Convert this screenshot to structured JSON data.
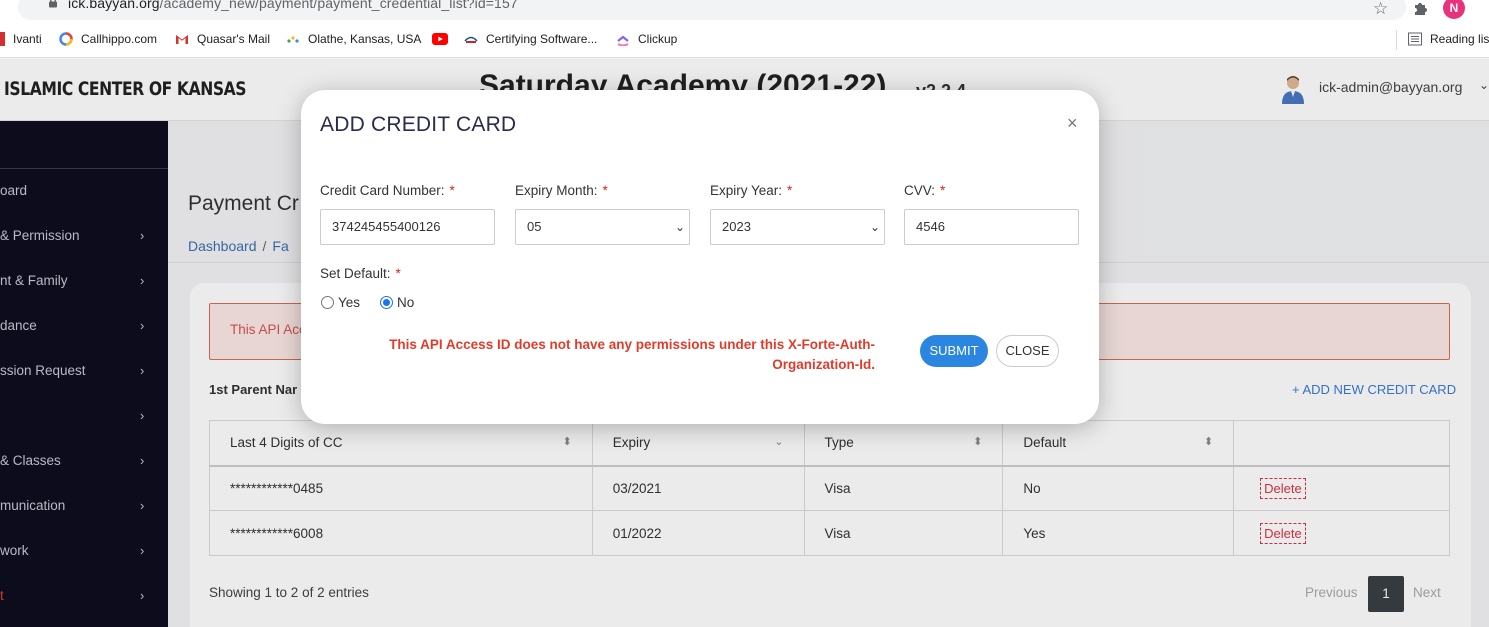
{
  "browser": {
    "url_host": "ick.bayyan.org",
    "url_path": "/academy_new/payment/payment_credential_list?id=157",
    "profile_initial": "N",
    "bookmarks": {
      "ivanti": "Ivanti",
      "callhippo": "Callhippo.com",
      "quasar_mail": "Quasar's Mail",
      "olathe": "Olathe, Kansas, USA",
      "certifying": "Certifying Software...",
      "clickup": "Clickup",
      "reading_list": "Reading lis"
    }
  },
  "header": {
    "org_name": "ISLAMIC CENTER OF KANSAS",
    "app_title": "Saturday Academy (2021-22)",
    "version": "v2.2.4",
    "user_email": "ick-admin@bayyan.org"
  },
  "sidebar": {
    "items": [
      {
        "label": "oard"
      },
      {
        "label": "& Permission"
      },
      {
        "label": "nt & Family"
      },
      {
        "label": "dance"
      },
      {
        "label": "ssion Request"
      },
      {
        "label": ""
      },
      {
        "label": "& Classes"
      },
      {
        "label": "munication"
      },
      {
        "label": "work"
      },
      {
        "label": "t"
      }
    ]
  },
  "main": {
    "page_title": "Payment Cr",
    "breadcrumb": {
      "home": "Dashboard",
      "sep": "/",
      "next": "Fa"
    },
    "alert_text": "This API Acc",
    "parent_label": "1st Parent Nar",
    "add_link": "+ ADD NEW CREDIT CARD",
    "table": {
      "headers": [
        "Last 4 Digits of CC",
        "Expiry",
        "Type",
        "Default",
        ""
      ],
      "rows": [
        {
          "cc": "************0485",
          "expiry": "03/2021",
          "type": "Visa",
          "default": "No",
          "action": "Delete"
        },
        {
          "cc": "************6008",
          "expiry": "01/2022",
          "type": "Visa",
          "default": "Yes",
          "action": "Delete"
        }
      ]
    },
    "showing": "Showing 1 to 2 of 2 entries",
    "pagination": {
      "prev": "Previous",
      "current": "1",
      "next": "Next"
    }
  },
  "modal": {
    "title": "ADD CREDIT CARD",
    "close_symbol": "×",
    "fields": {
      "cc_number": {
        "label": "Credit Card Number:",
        "value": "374245455400126"
      },
      "expiry_month": {
        "label": "Expiry Month:",
        "value": "05"
      },
      "expiry_year": {
        "label": "Expiry Year:",
        "value": "2023"
      },
      "cvv": {
        "label": "CVV:",
        "value": "4546"
      }
    },
    "required_marker": "*",
    "set_default": {
      "label": "Set Default:",
      "options": [
        "Yes",
        "No"
      ],
      "selected": "No"
    },
    "error": "This API Access ID does not have any permissions under this X-Forte-Auth-Organization-Id.",
    "submit_label": "SUBMIT",
    "close_label": "CLOSE"
  },
  "colors": {
    "sidebar_bg": "#0f0e1f",
    "submit_bg": "#2a86e0",
    "error_red": "#e23b2b",
    "link_blue": "#3a7bd5"
  }
}
